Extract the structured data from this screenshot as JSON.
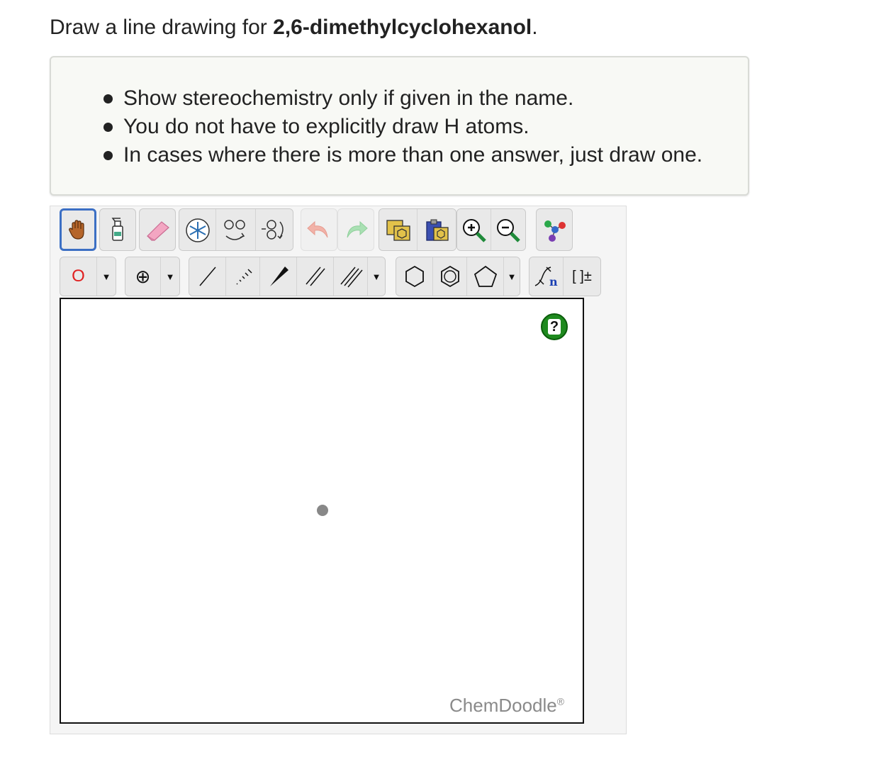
{
  "question": {
    "prefix": "Draw a line drawing for ",
    "compound": "2,6-dimethylcyclohexanol",
    "suffix": "."
  },
  "instructions": [
    "Show stereochemistry only if given in the name.",
    "You do not have to explicitly draw H atoms.",
    "In cases where there is more than one answer, just draw one."
  ],
  "toolbar": {
    "element_label": "O",
    "element_color": "#e02020",
    "charge_symbol": "⊕",
    "sgroup_n": "n",
    "bracket_label": "[ ]±"
  },
  "canvas": {
    "help_label": "?",
    "brand": "ChemDoodle",
    "brand_mark": "®"
  }
}
